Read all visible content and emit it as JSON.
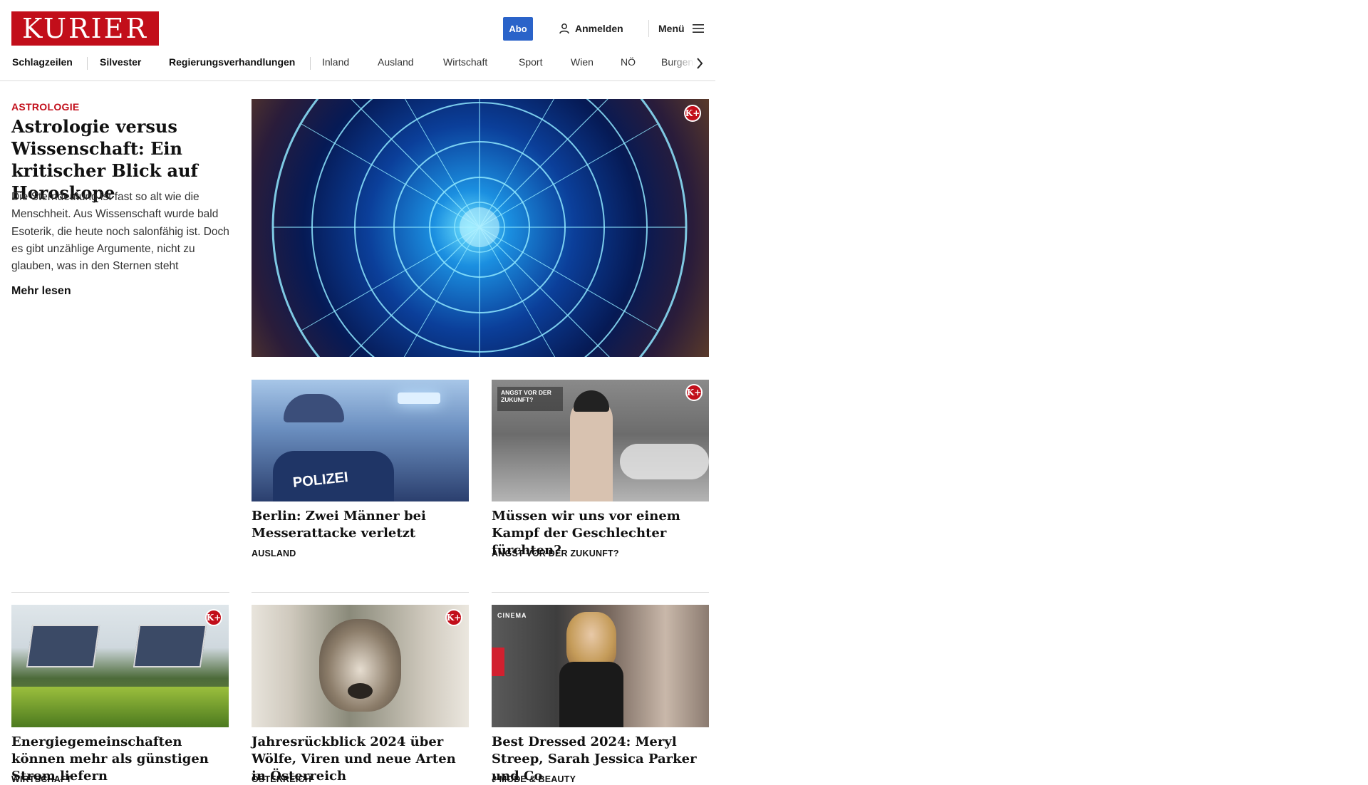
{
  "brand": {
    "logo_text": "KURIER",
    "accent_color": "#c20e1a",
    "abo_color": "#2a63c9"
  },
  "header": {
    "abo_label": "Abo",
    "login_label": "Anmelden",
    "menu_label": "Menü"
  },
  "nav": {
    "items": [
      "Schlagzeilen",
      "Silvester",
      "Regierungsverhandlungen",
      "Inland",
      "Ausland",
      "Wirtschaft",
      "Sport",
      "Wien",
      "NÖ",
      "Burgenl"
    ]
  },
  "lead": {
    "kicker": "ASTROLOGIE",
    "title": "Astrologie versus Wis­senschaft: Ein kritischer Blick auf Horoskope",
    "teaser": "Die Sterndeutung ist fast so alt wie die Menschheit. Aus Wissenschaft wurde bald Esoterik, die heute noch salonfähig ist. Doch es gibt unzählige Argumente, nicht zu glauben, was in den Sternen steht",
    "more_label": "Mehr lesen",
    "image_icon": "zodiac-wheel-image",
    "premium_badge": "K+"
  },
  "cards": [
    {
      "title": "Berlin: Zwei Männer bei Messerat­tacke verletzt",
      "category": "AUSLAND",
      "image_icon": "police-officer-photo",
      "premium": false
    },
    {
      "title": "Müssen wir uns vor einem Kampf der Geschlechter fürchten?",
      "category": "ANGST VOR DER ZUKUNFT?",
      "image_icon": "protest-photo",
      "image_caption": "ANGST VOR DER ZUKUNFT?",
      "premium": true
    },
    {
      "title": "Energiegemeinschaften können mehr als günstigen Strom liefern",
      "category": "WIRTSCHAFT",
      "image_icon": "solar-roof-photo",
      "premium": true
    },
    {
      "title": "Jahresrückblick 2024 über Wölfe, Viren und neue Arten in Österreich",
      "category": "ÖSTERREICH",
      "image_icon": "wolf-photo",
      "premium": true
    },
    {
      "title": "Best Dressed 2024: Meryl Streep, Sarah Jessica Parker und Co",
      "category": "MODE & BEAUTY",
      "image_icon": "red-carpet-photo",
      "image_caption": "CINEMA",
      "premium": false
    }
  ]
}
